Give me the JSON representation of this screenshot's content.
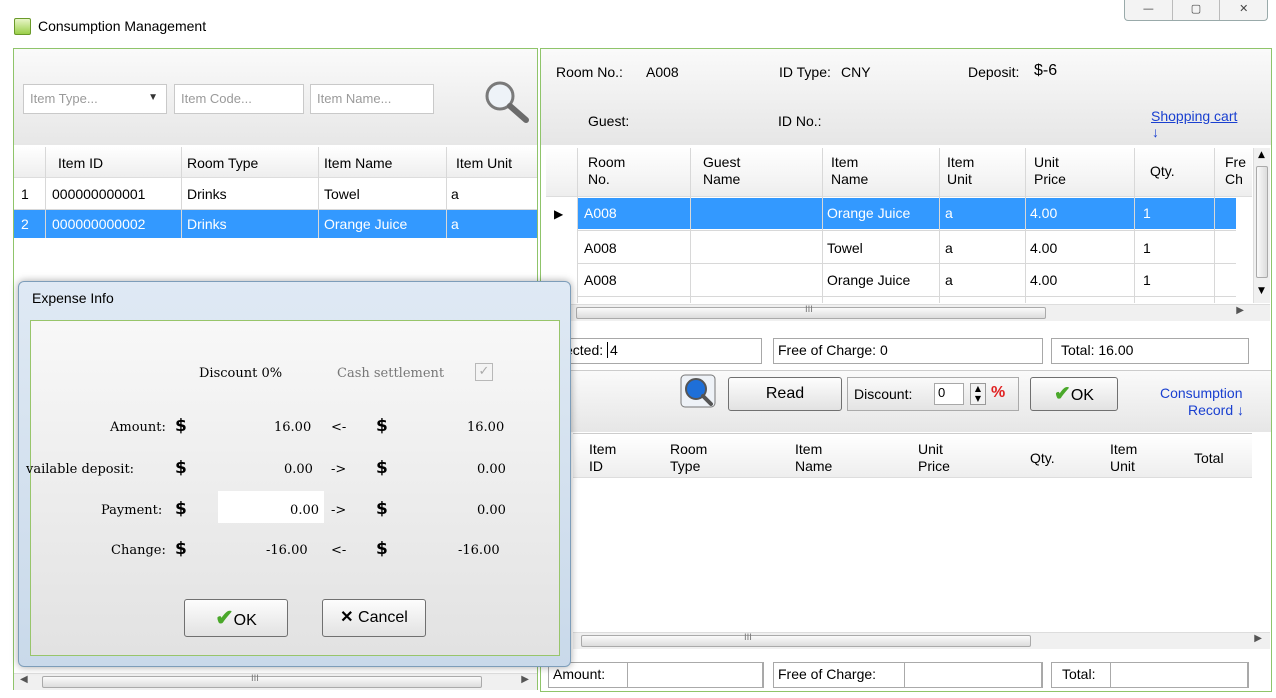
{
  "window": {
    "title": "Consumption Management",
    "minimize": "—",
    "maximize": "▢",
    "close": "✕"
  },
  "left": {
    "search": {
      "item_type": "Item Type...",
      "item_code": "Item Code...",
      "item_name": "Item Name..."
    },
    "columns": [
      "Item ID",
      "Room Type",
      "Item Name",
      "Item Unit"
    ],
    "rows": [
      {
        "n": "1",
        "id": "000000000001",
        "room_type": "Drinks",
        "name": "Towel",
        "unit": "a"
      },
      {
        "n": "2",
        "id": "000000000002",
        "room_type": "Drinks",
        "name": "Orange Juice",
        "unit": "a"
      }
    ],
    "scroll_mark": "III"
  },
  "info": {
    "room_label": "Room No.:",
    "room_value": "A008",
    "idtype_label": "ID Type:",
    "idtype_value": "CNY",
    "deposit_label": "Deposit:",
    "deposit_value": "$-6",
    "guest_label": "Guest:",
    "idno_label": "ID No.:",
    "cart_link": "Shopping cart",
    "cart_arrow": "↓"
  },
  "cart": {
    "columns": [
      [
        "Room",
        "No."
      ],
      [
        "Guest",
        "Name"
      ],
      [
        "Item",
        "Name"
      ],
      [
        "Item",
        "Unit"
      ],
      [
        "Unit",
        "Price"
      ],
      [
        "Qty."
      ],
      [
        "Fre",
        "Ch"
      ]
    ],
    "rows": [
      {
        "room": "A008",
        "guest": "",
        "item": "Orange Juice",
        "unit": "a",
        "price": "4.00",
        "qty": "1"
      },
      {
        "room": "A008",
        "guest": "",
        "item": "Towel",
        "unit": "a",
        "price": "4.00",
        "qty": "1"
      },
      {
        "room": "A008",
        "guest": "",
        "item": "Orange Juice",
        "unit": "a",
        "price": "4.00",
        "qty": "1"
      }
    ],
    "scroll_mark": "III",
    "selected_label": "ected:",
    "selected_value": "4",
    "free_label": "Free of Charge:",
    "free_value": "0",
    "total_label": "Total:",
    "total_value": "16.00"
  },
  "actions": {
    "read": "Read",
    "discount_label": "Discount:",
    "discount_value": "0",
    "percent": "%",
    "ok": "OK",
    "record_link_1": "Consumption",
    "record_link_2": "Record ↓"
  },
  "record": {
    "columns": [
      [
        "Item",
        "ID"
      ],
      [
        "Room",
        "Type"
      ],
      [
        "Item",
        "Name"
      ],
      [
        "Unit",
        "Price"
      ],
      [
        "Qty."
      ],
      [
        "Item",
        "Unit"
      ],
      [
        "Total"
      ]
    ],
    "scroll_mark": "III",
    "amount_label": "Amount:",
    "free_label": "Free of Charge:",
    "total_label": "Total:"
  },
  "dialog": {
    "title": "Expense Info",
    "discount": "Discount 0%",
    "cash_settlement": "Cash settlement",
    "cash_checked": true,
    "amount_label": "Amount:",
    "amount_left": "16.00",
    "amount_arrow": "<-",
    "amount_right": "16.00",
    "deposit_label": "vailable deposit:",
    "deposit_left": "0.00",
    "deposit_arrow": "->",
    "deposit_right": "0.00",
    "payment_label": "Payment:",
    "payment_value": "0.00",
    "payment_arrow": "->",
    "payment_right": "0.00",
    "change_label": "Change:",
    "change_left": "-16.00",
    "change_arrow": "<-",
    "change_right": "-16.00",
    "currency": "$",
    "ok": "OK",
    "cancel": "Cancel"
  }
}
